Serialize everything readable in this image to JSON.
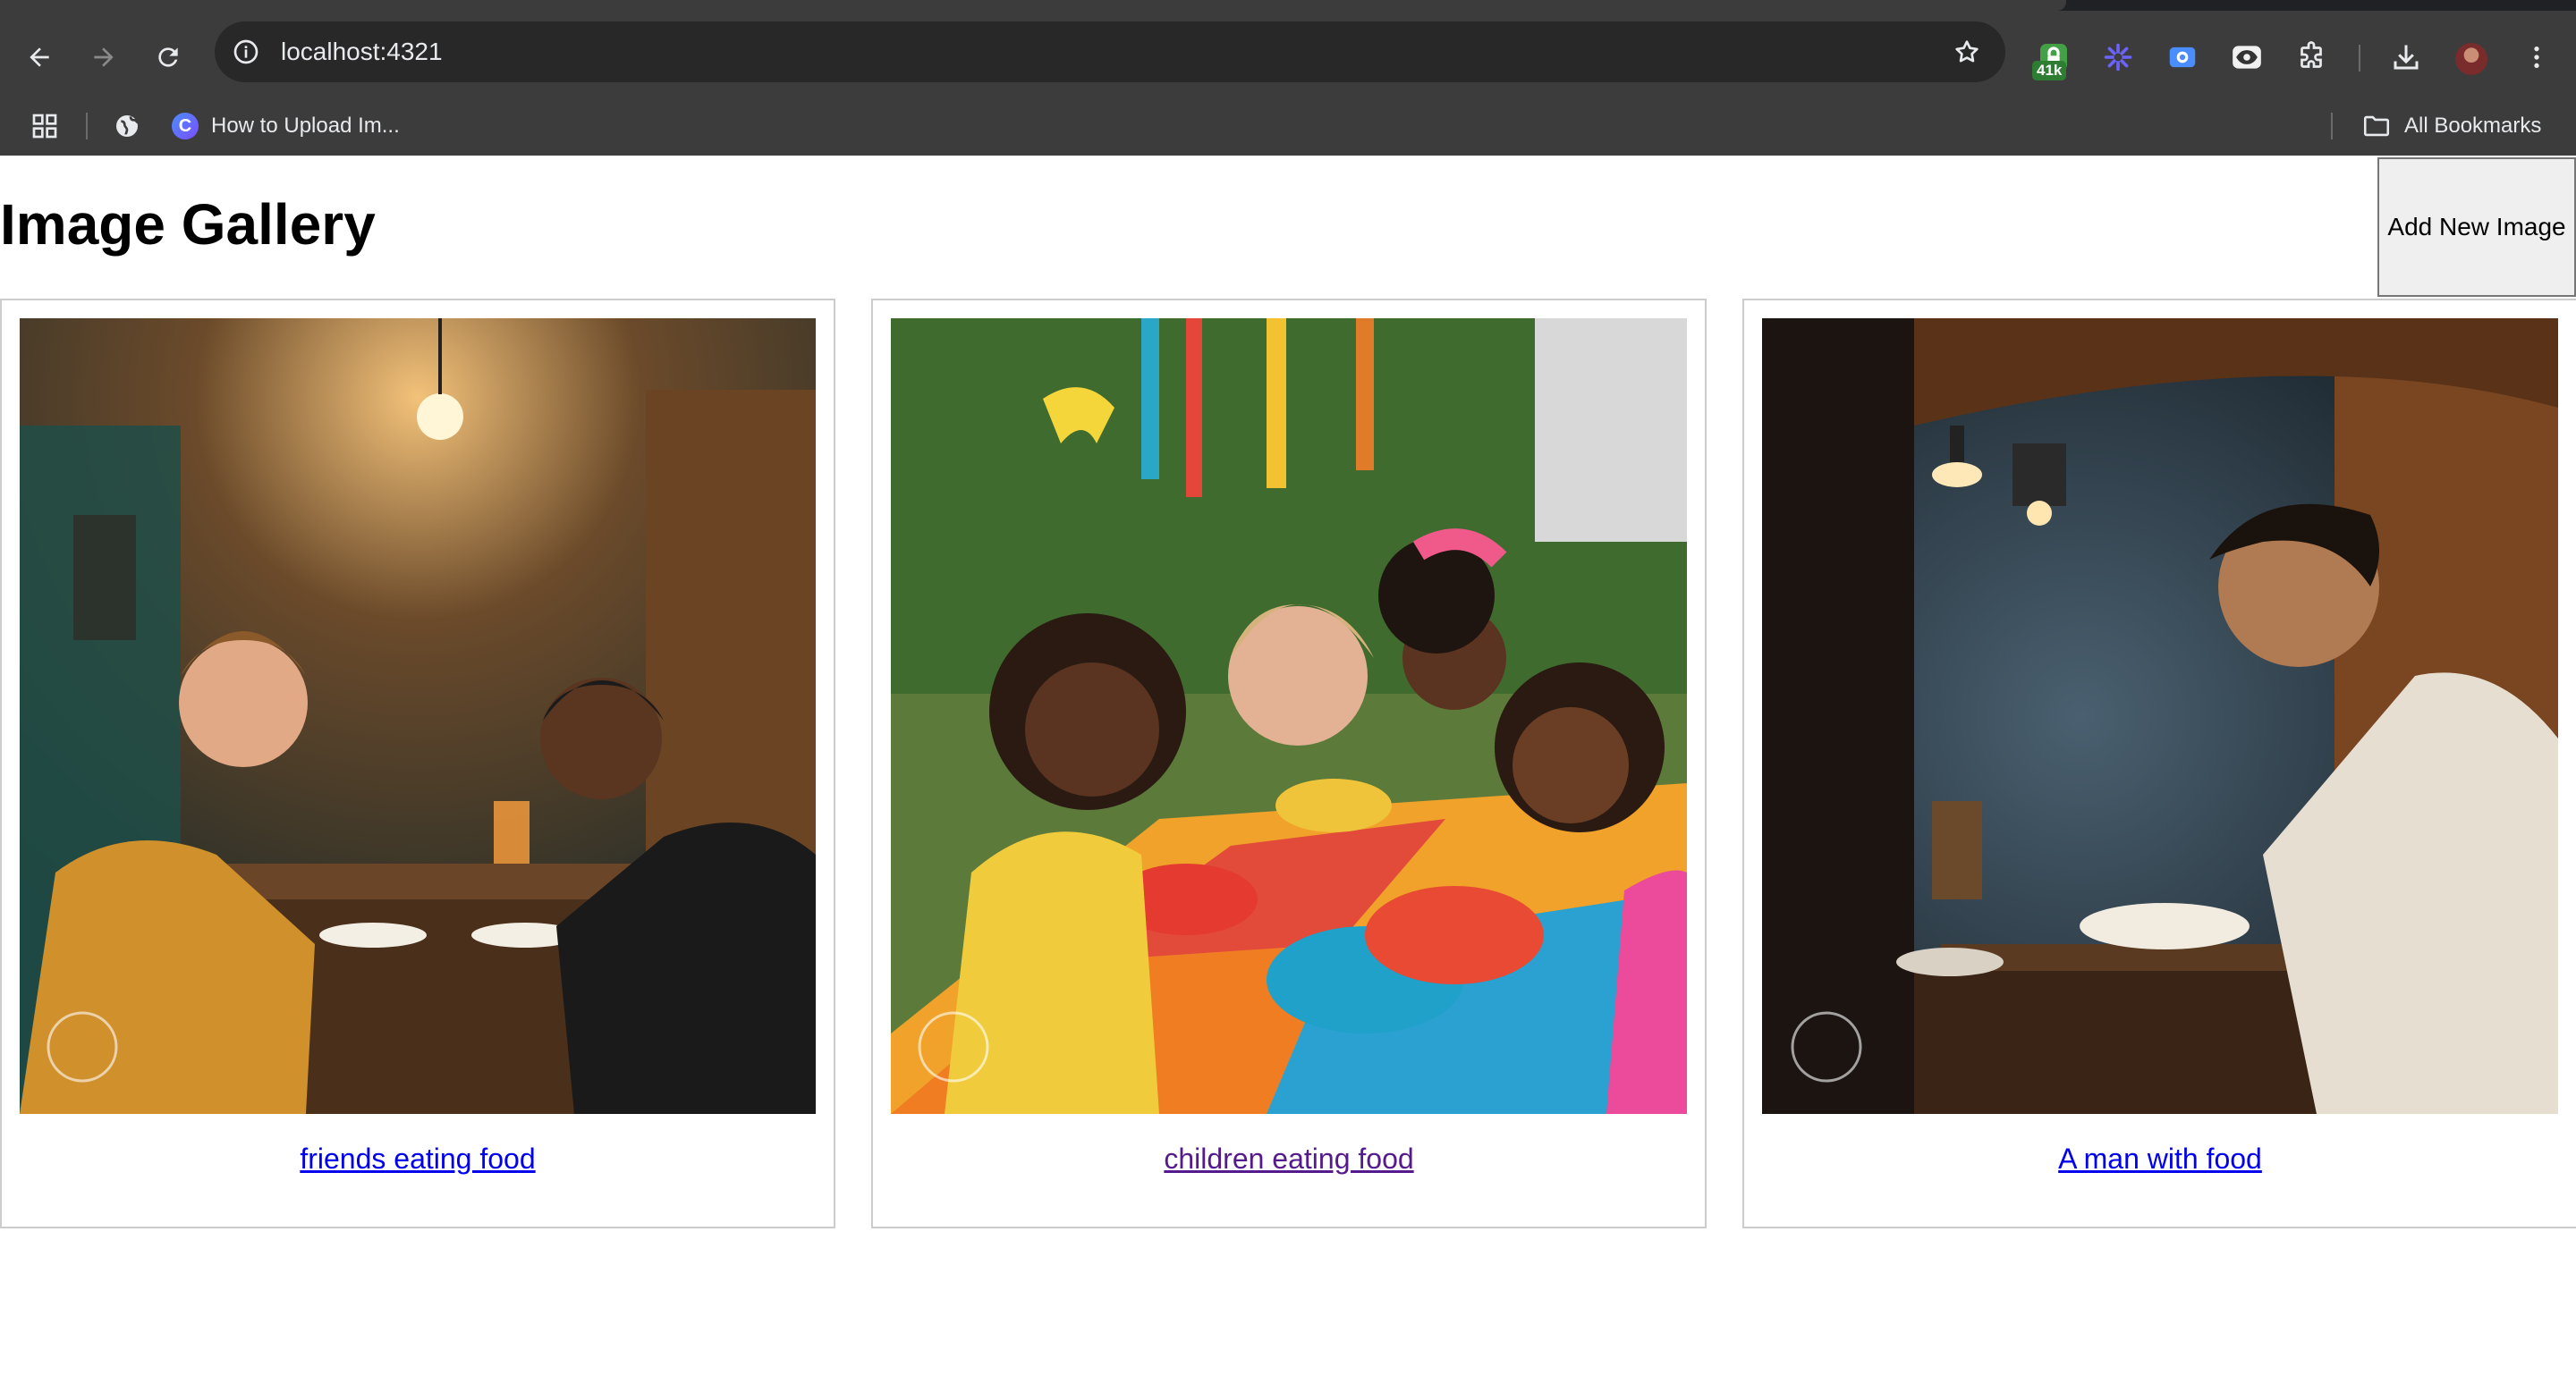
{
  "browser": {
    "url": "localhost:4321",
    "extension_badge": "41k",
    "bookmarks": [
      {
        "label": "How to Upload Im...",
        "icon": "c-logo-icon"
      }
    ],
    "all_bookmarks_label": "All Bookmarks"
  },
  "page": {
    "title": "Image Gallery",
    "add_button_label": "Add New Image",
    "gallery": [
      {
        "caption": "friends eating food",
        "visited": false
      },
      {
        "caption": "children eating food",
        "visited": true
      },
      {
        "caption": "A man with food",
        "visited": false
      }
    ]
  },
  "colors": {
    "link": "#0000ee",
    "link_visited": "#551a8b",
    "chrome_bg": "#3c3c3c"
  }
}
